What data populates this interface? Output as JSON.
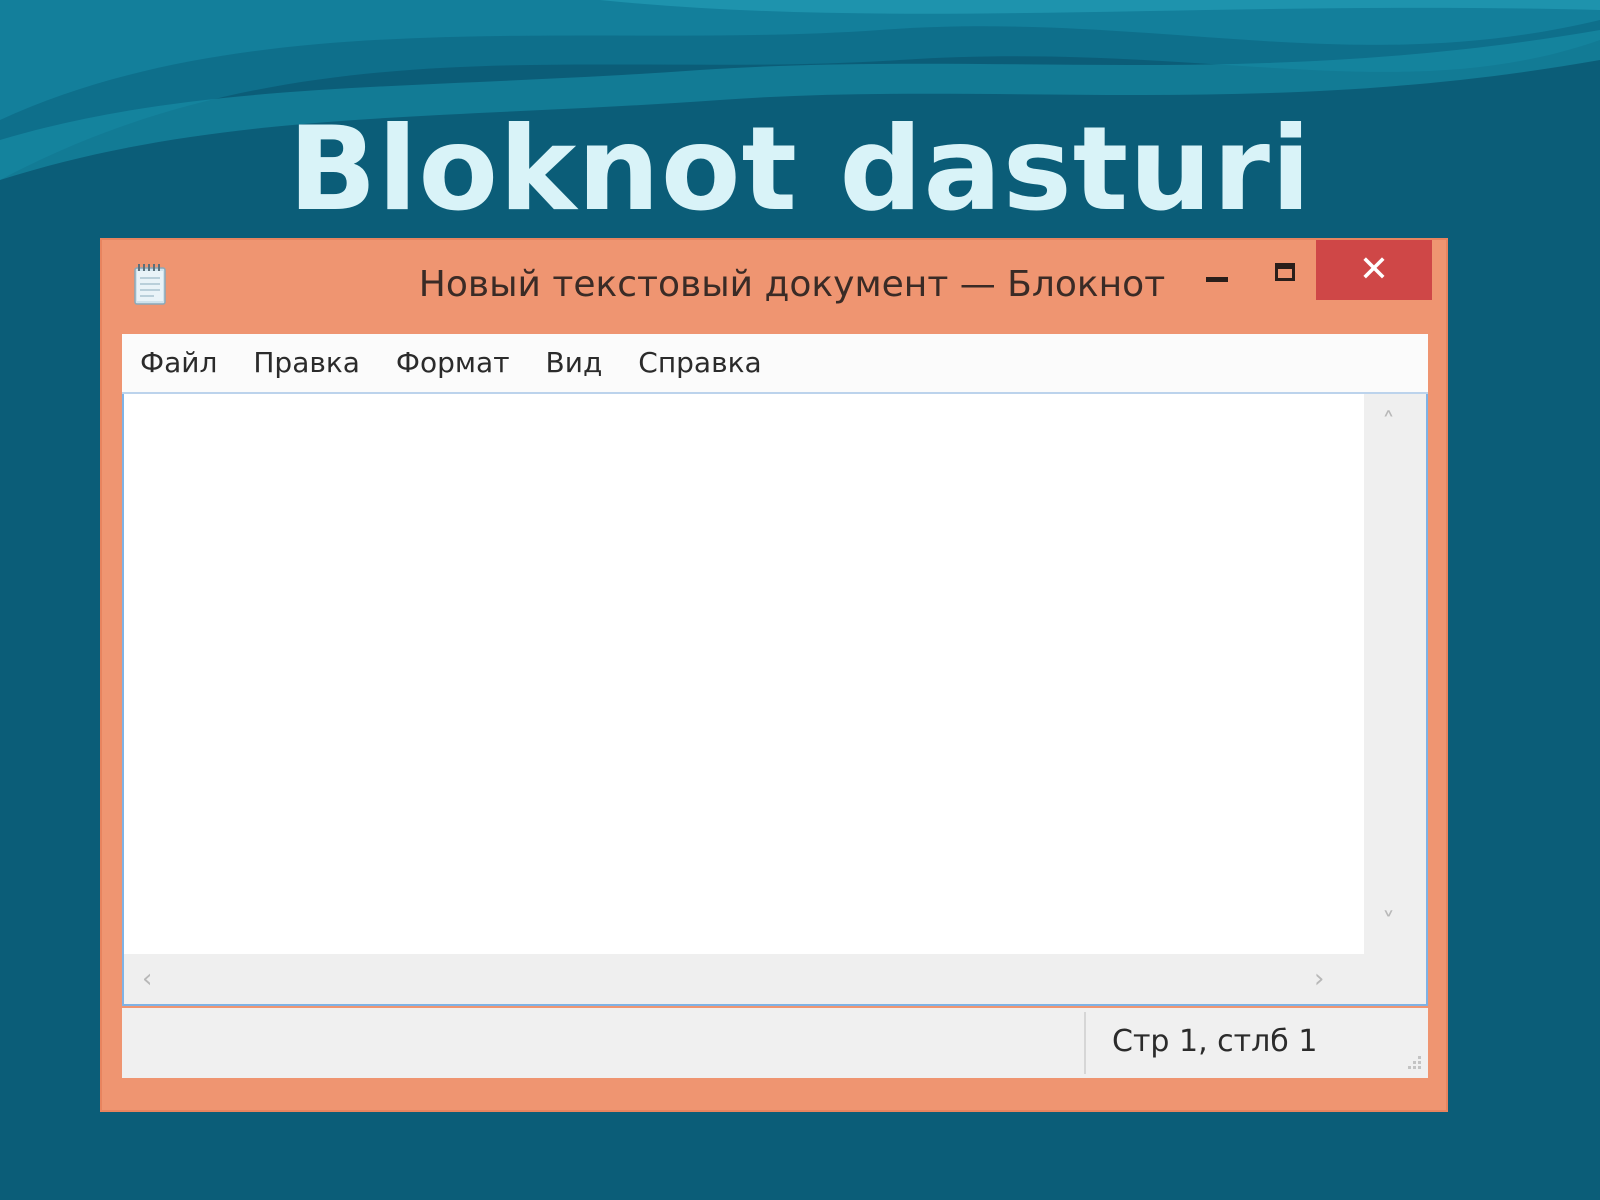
{
  "slide": {
    "title": "Bloknot dasturi"
  },
  "window": {
    "title": "Новый текстовый документ — Блокнот",
    "icon": "notepad-icon",
    "controls": {
      "minimize_icon": "minimize-icon",
      "maximize_icon": "maximize-icon",
      "close_icon": "close-icon",
      "close_glyph": "✕"
    }
  },
  "menu": {
    "items": [
      {
        "label": "Файл"
      },
      {
        "label": "Правка"
      },
      {
        "label": "Формат"
      },
      {
        "label": "Вид"
      },
      {
        "label": "Справка"
      }
    ]
  },
  "editor": {
    "value": ""
  },
  "scrollbars": {
    "up": "˄",
    "down": "˅",
    "left": "‹",
    "right": "›"
  },
  "status": {
    "position": "Стр 1, стлб 1"
  },
  "colors": {
    "background": "#0b5d78",
    "window_frame": "#ef9571",
    "close_button": "#cf4747",
    "title_text": "#d9f3f8"
  }
}
